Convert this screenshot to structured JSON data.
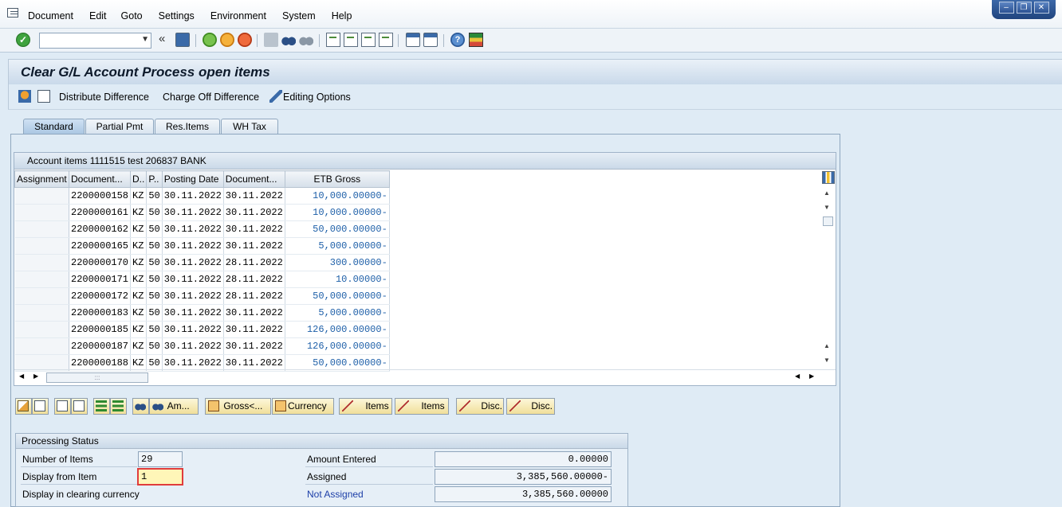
{
  "menu": [
    "Document",
    "Edit",
    "Goto",
    "Settings",
    "Environment",
    "System",
    "Help"
  ],
  "window_controls": [
    "minimize-icon",
    "restore-icon",
    "close-icon"
  ],
  "command_field": {
    "value": ""
  },
  "title": "Clear G/L Account Process open items",
  "app_toolbar": {
    "distribute": "Distribute Difference",
    "charge_off": "Charge Off Difference",
    "editing": "Editing Options"
  },
  "tabs": [
    "Standard",
    "Partial Pmt",
    "Res.Items",
    "WH Tax"
  ],
  "active_tab": "Standard",
  "grid": {
    "title": "Account items 1111515 test 206837 BANK",
    "columns": [
      "Assignment",
      "Document...",
      "D..",
      "P..",
      "Posting Date",
      "Document...",
      "ETB Gross"
    ],
    "rows": [
      [
        "",
        "2200000158",
        "KZ",
        "50",
        "30.11.2022",
        "30.11.2022",
        "10,000.00000-"
      ],
      [
        "",
        "2200000161",
        "KZ",
        "50",
        "30.11.2022",
        "30.11.2022",
        "10,000.00000-"
      ],
      [
        "",
        "2200000162",
        "KZ",
        "50",
        "30.11.2022",
        "30.11.2022",
        "50,000.00000-"
      ],
      [
        "",
        "2200000165",
        "KZ",
        "50",
        "30.11.2022",
        "30.11.2022",
        "5,000.00000-"
      ],
      [
        "",
        "2200000170",
        "KZ",
        "50",
        "30.11.2022",
        "28.11.2022",
        "300.00000-"
      ],
      [
        "",
        "2200000171",
        "KZ",
        "50",
        "30.11.2022",
        "28.11.2022",
        "10.00000-"
      ],
      [
        "",
        "2200000172",
        "KZ",
        "50",
        "30.11.2022",
        "28.11.2022",
        "50,000.00000-"
      ],
      [
        "",
        "2200000183",
        "KZ",
        "50",
        "30.11.2022",
        "30.11.2022",
        "5,000.00000-"
      ],
      [
        "",
        "2200000185",
        "KZ",
        "50",
        "30.11.2022",
        "30.11.2022",
        "126,000.00000-"
      ],
      [
        "",
        "2200000187",
        "KZ",
        "50",
        "30.11.2022",
        "30.11.2022",
        "126,000.00000-"
      ],
      [
        "",
        "2200000188",
        "KZ",
        "50",
        "30.11.2022",
        "30.11.2022",
        "50,000.00000-"
      ]
    ]
  },
  "grid_toolbar": {
    "am": "Am...",
    "gross": "Gross<...",
    "currency": "Currency",
    "items1": "Items",
    "items2": "Items",
    "disc1": "Disc.",
    "disc2": "Disc."
  },
  "status": {
    "title": "Processing Status",
    "num_items_label": "Number of Items",
    "num_items": "29",
    "display_from_label": "Display from Item",
    "display_from": "1",
    "display_currency_label": "Display in clearing currency",
    "amount_entered_label": "Amount Entered",
    "amount_entered": "0.00000",
    "assigned_label": "Assigned",
    "assigned": "3,385,560.00000-",
    "not_assigned_label": "Not Assigned",
    "not_assigned": "3,385,560.00000"
  }
}
